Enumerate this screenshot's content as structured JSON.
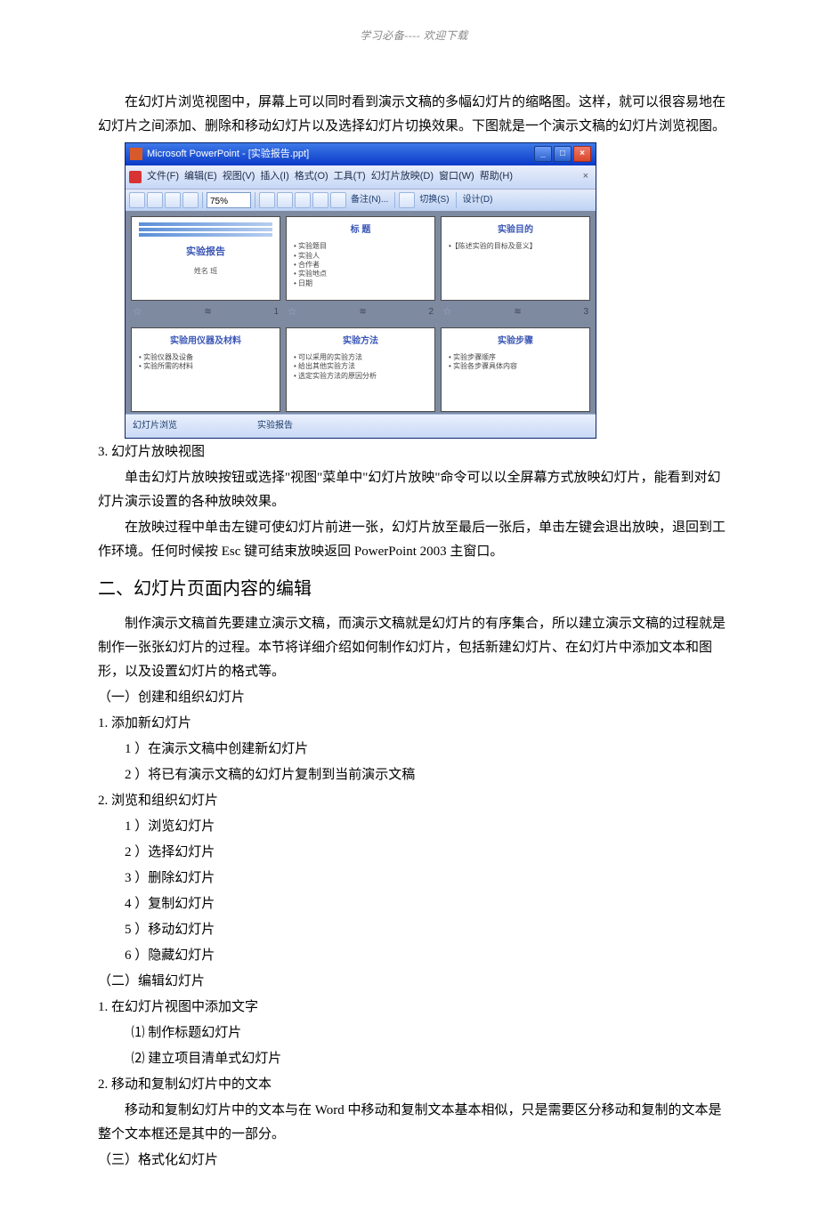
{
  "header_note": "学习必备---- 欢迎下载",
  "para1": "在幻灯片浏览视图中，屏幕上可以同时看到演示文稿的多幅幻灯片的缩略图。这样，就可以很容易地在幻灯片之间添加、删除和移动幻灯片以及选择幻灯片切换效果。下图就是一个演示文稿的幻灯片浏览视图。",
  "ppwin": {
    "title": "Microsoft PowerPoint - [实验报告.ppt]",
    "menus": [
      "文件(F)",
      "编辑(E)",
      "视图(V)",
      "插入(I)",
      "格式(O)",
      "工具(T)",
      "幻灯片放映(D)",
      "窗口(W)",
      "帮助(H)"
    ],
    "zoom": "75%",
    "tb_notes": "备注(N)...",
    "tb_switch": "切换(S)",
    "tb_design": "设计(D)",
    "slides": [
      {
        "title": "实验报告",
        "sub": "姓名 班",
        "type": "title"
      },
      {
        "title": "标 题",
        "body": [
          "• 实验题目",
          "• 实验人",
          "• 合作者",
          "• 实验地点",
          "• 日期"
        ]
      },
      {
        "title": "实验目的",
        "body": [
          "•【陈述实验的目标及意义】"
        ]
      },
      {
        "title": "实验用仪器及材料",
        "body": [
          "• 实验仪器及设备",
          "• 实验所需的材料"
        ]
      },
      {
        "title": "实验方法",
        "body": [
          "• 可以采用的实验方法",
          "• 给出其他实验方法",
          "• 选定实验方法的原因分析"
        ]
      },
      {
        "title": "实验步骤",
        "body": [
          "• 实验步骤顺序",
          "• 实验各步骤具体内容"
        ]
      }
    ],
    "slide_nums": [
      "1",
      "2",
      "3"
    ],
    "status_left": "幻灯片浏览",
    "status_right": "实验报告"
  },
  "sec3_title": "3.  幻灯片放映视图",
  "sec3_p1": "单击幻灯片放映按钮或选择\"视图\"菜单中\"幻灯片放映\"命令可以以全屏幕方式放映幻灯片，能看到对幻灯片演示设置的各种放映效果。",
  "sec3_p2": "在放映过程中单击左键可使幻灯片前进一张，幻灯片放至最后一张后，单击左键会退出放映，退回到工作环境。任何时候按 Esc 键可结束放映返回 PowerPoint 2003   主窗口。",
  "h2_1": "二、幻灯片页面内容的编辑",
  "h2_1_p1": "制作演示文稿首先要建立演示文稿，而演示文稿就是幻灯片的有序集合，所以建立演示文稿的过程就是制作一张张幻灯片的过程。本节将详细介绍如何制作幻灯片，包括新建幻灯片、在幻灯片中添加文本和图形，以及设置幻灯片的格式等。",
  "s1_title": "（一）创建和组织幻灯片",
  "s1_1": "1.  添加新幻灯片",
  "s1_1_1": "1   ）在演示文稿中创建新幻灯片",
  "s1_1_2": "2   ）将已有演示文稿的幻灯片复制到当前演示文稿",
  "s1_2": "2.  浏览和组织幻灯片",
  "s1_2_1": "1   ）浏览幻灯片",
  "s1_2_2": "2   ）选择幻灯片",
  "s1_2_3": "3   ）删除幻灯片",
  "s1_2_4": "4   ）复制幻灯片",
  "s1_2_5": "5   ）移动幻灯片",
  "s1_2_6": "6   ）隐藏幻灯片",
  "s2_title": "（二）编辑幻灯片",
  "s2_1": "1.  在幻灯片视图中添加文字",
  "s2_1_1": "⑴ 制作标题幻灯片",
  "s2_1_2": "⑵ 建立项目清单式幻灯片",
  "s2_2": "2.  移动和复制幻灯片中的文本",
  "s2_2_p": "移动和复制幻灯片中的文本与在 Word 中移动和复制文本基本相似，只是需要区分移动和复制的文本是整个文本框还是其中的一部分。",
  "s3_title": "（三）格式化幻灯片"
}
